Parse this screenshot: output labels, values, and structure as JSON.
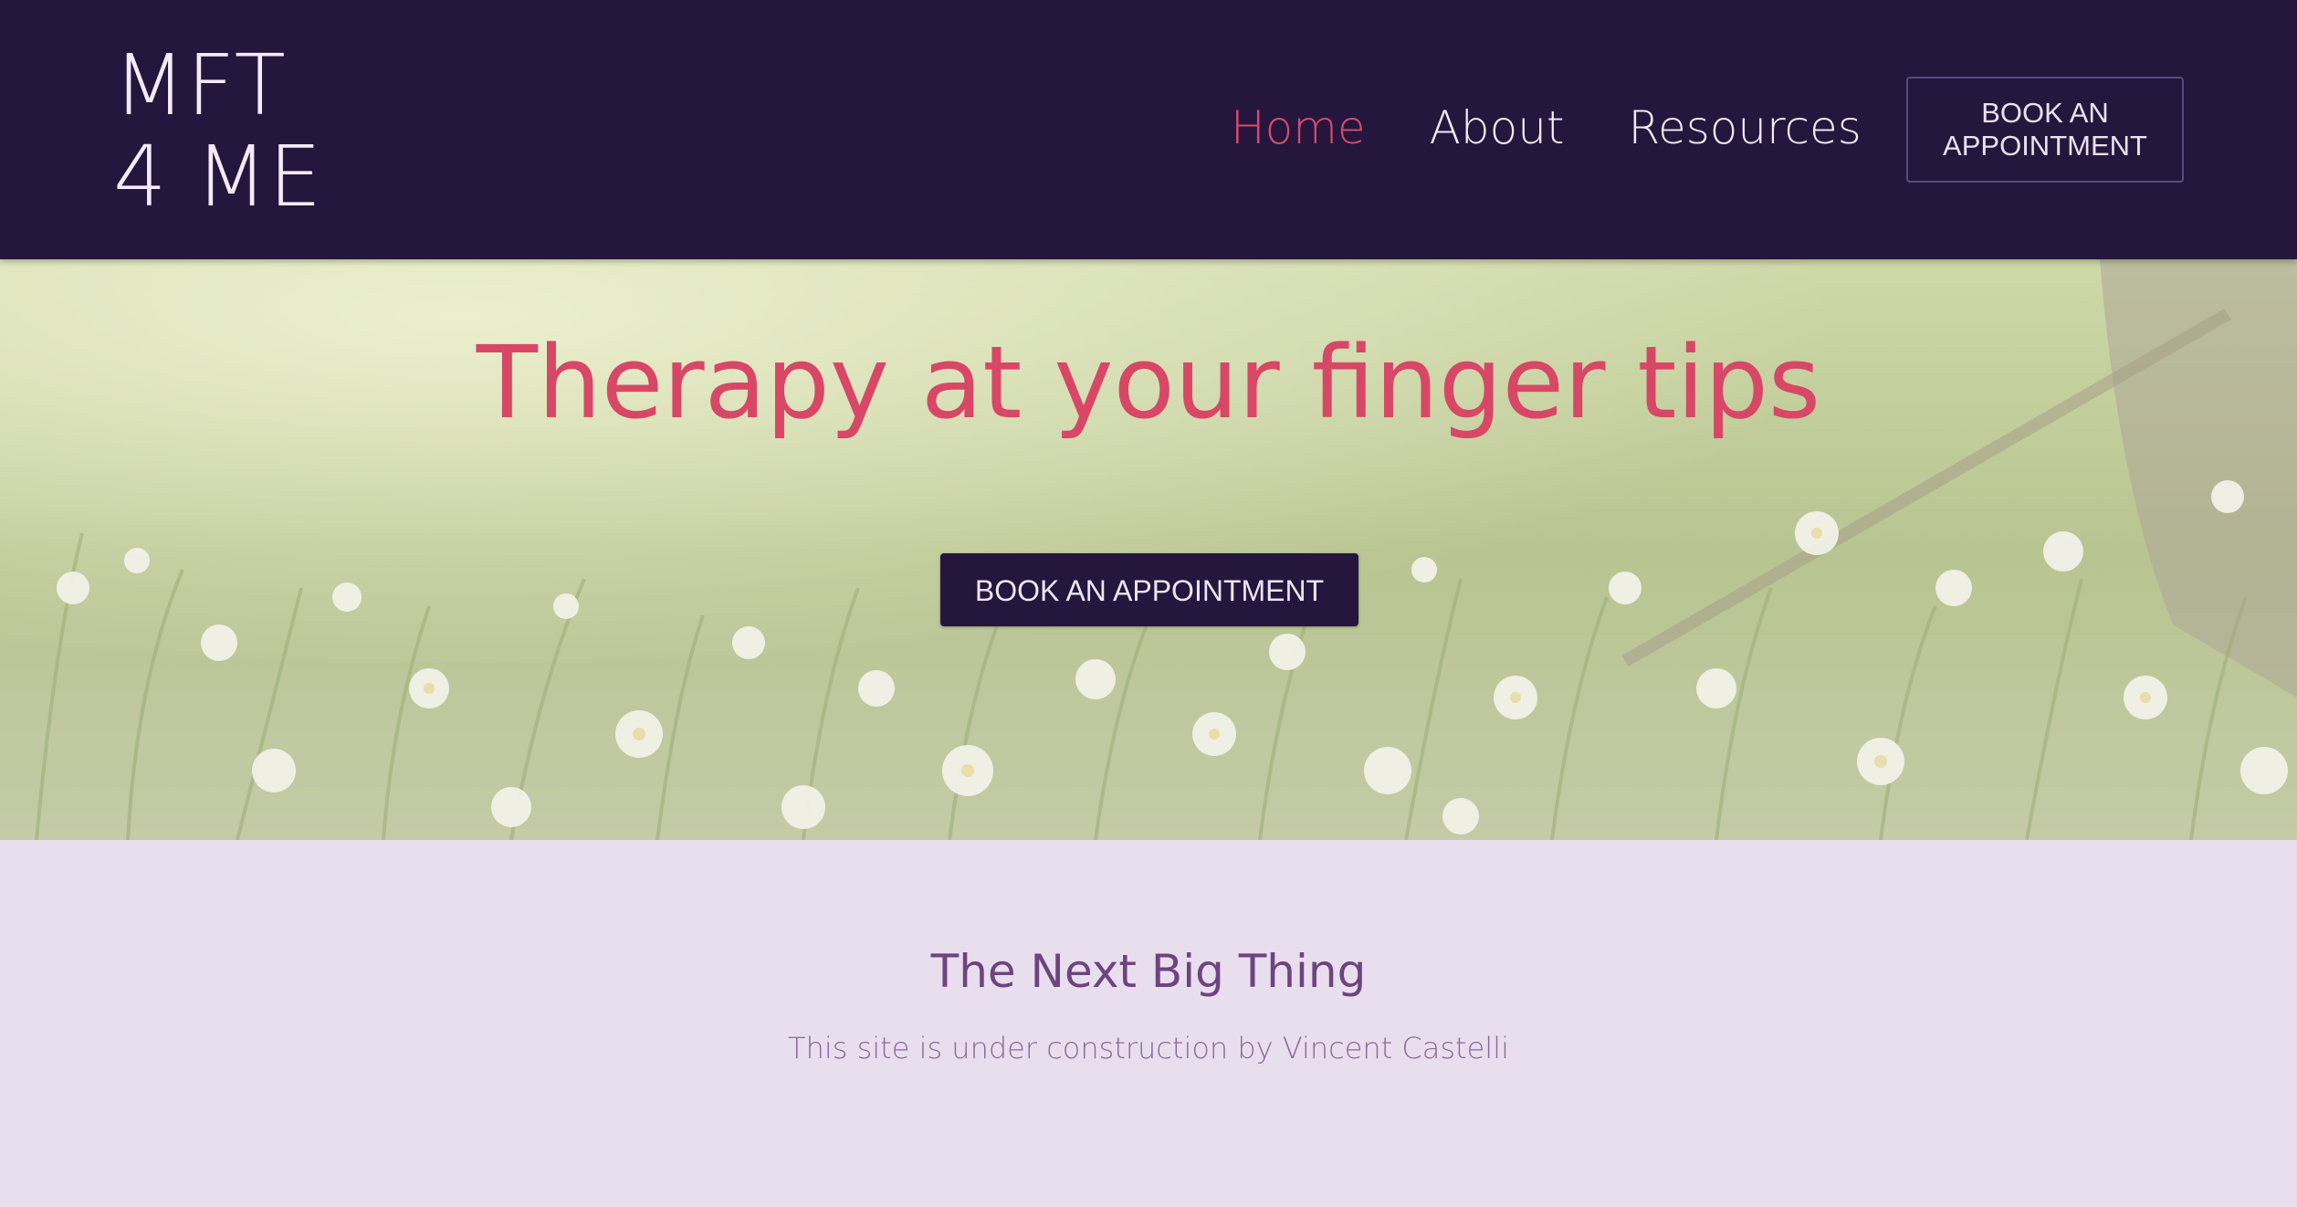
{
  "site": {
    "logo_line1": "MFT",
    "logo_line2": "4 ME"
  },
  "nav": {
    "items": [
      {
        "label": "Home",
        "active": true
      },
      {
        "label": "About",
        "active": false
      },
      {
        "label": "Resources",
        "active": false
      }
    ],
    "cta_line1": "BOOK AN",
    "cta_line2": "APPOINTMENT"
  },
  "hero": {
    "title": "Therapy at your finger tips",
    "cta_label": "BOOK AN APPOINTMENT",
    "background": "meadow-with-white-flowers-image"
  },
  "content": {
    "heading": "The Next Big Thing",
    "subtext": "This site is under construction by Vincent Castelli"
  },
  "colors": {
    "header_bg": "#25163e",
    "accent": "#d84766",
    "content_bg": "#e9deee",
    "heading": "#6e4480",
    "subtext": "#8a6a98"
  }
}
